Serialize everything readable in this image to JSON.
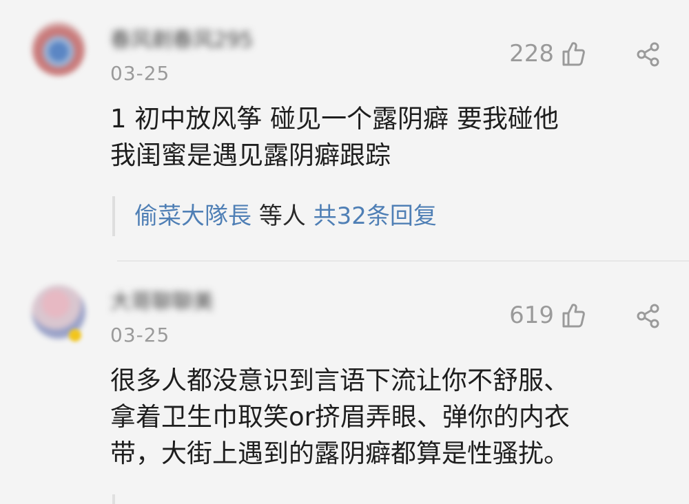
{
  "comments": [
    {
      "username": "春风剃春风295",
      "date": "03-25",
      "likes": "228",
      "text": "1 初中放风筝 碰见一个露阴癖 要我碰他\n我闺蜜是遇见露阴癖跟踪",
      "replies": {
        "user": "偷菜大隊長",
        "etc": "等人",
        "count": "共32条回复"
      }
    },
    {
      "username": "大哥聊聊美",
      "date": "03-25",
      "likes": "619",
      "text": "很多人都没意识到言语下流让你不舒服、\n拿着卫生巾取笑or挤眉弄眼、弹你的内衣\n带，大街上遇到的露阴癖都算是性骚扰。"
    }
  ],
  "icons": {
    "like": "thumbs-up-icon",
    "share": "share-icon"
  },
  "colors": {
    "background": "#f4f4f4",
    "link": "#4f7fb5",
    "meta": "#9a9a9a",
    "text": "#1e1e1e"
  }
}
